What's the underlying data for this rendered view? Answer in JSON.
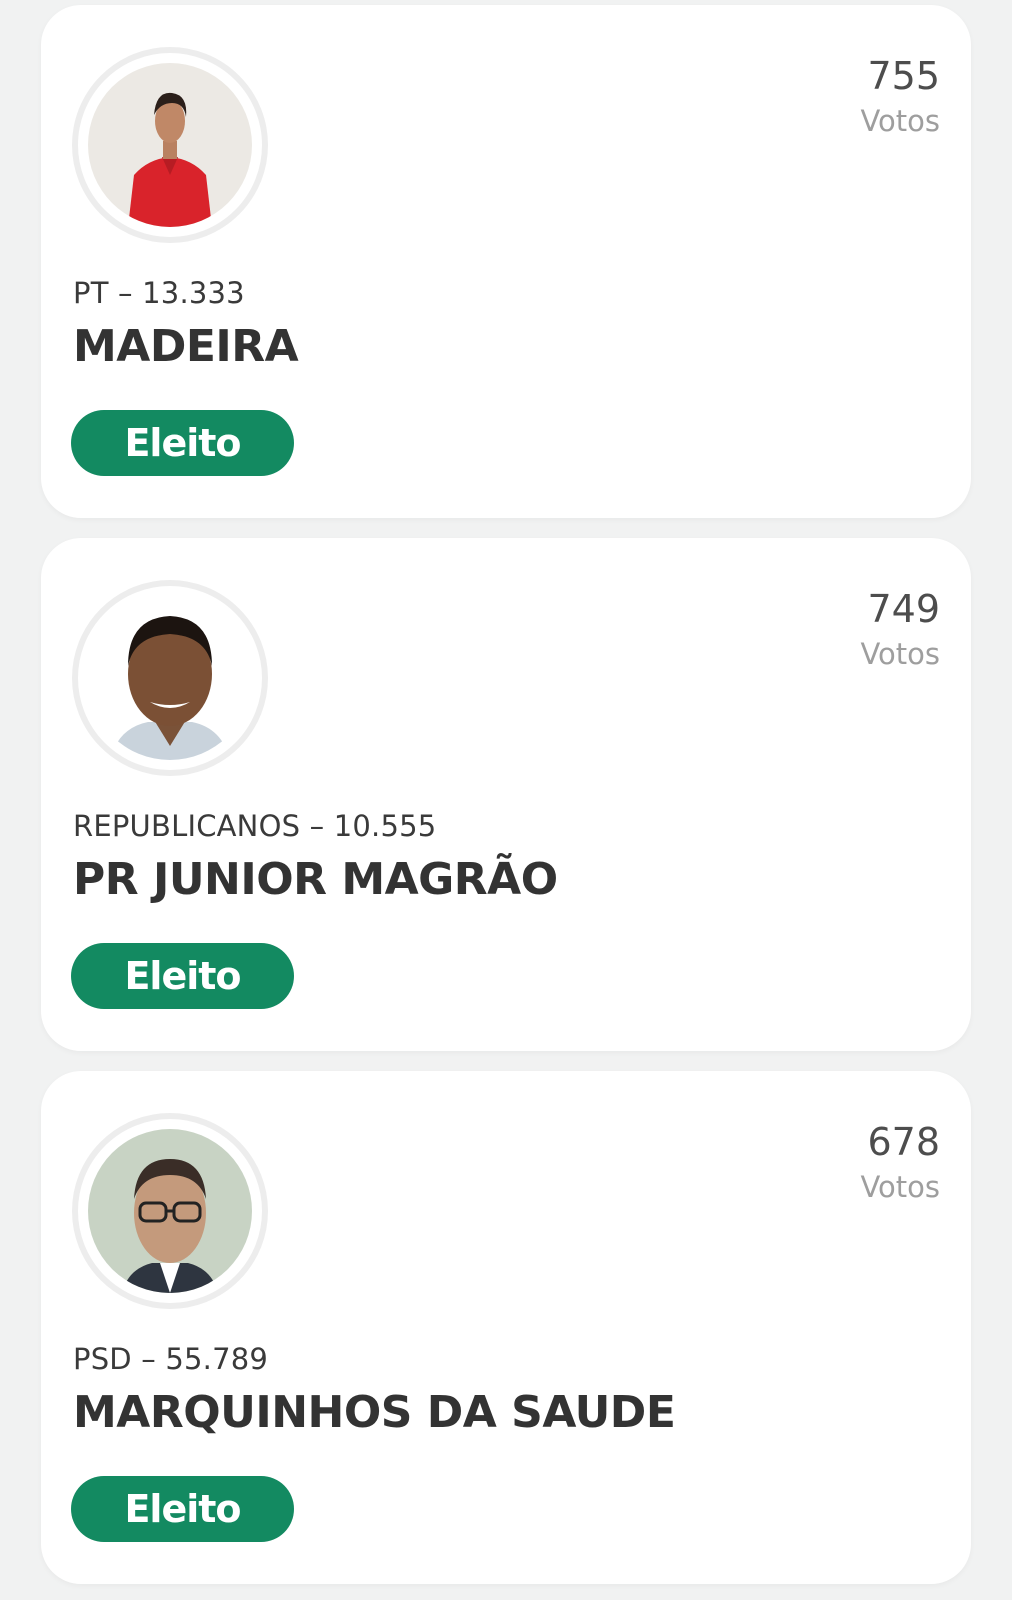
{
  "candidates": [
    {
      "votes": "755",
      "votes_label": "Votos",
      "party": "PT – 13.333",
      "name": "MADEIRA",
      "status": "Eleito"
    },
    {
      "votes": "749",
      "votes_label": "Votos",
      "party": "REPUBLICANOS – 10.555",
      "name": "PR JUNIOR MAGRÃO",
      "status": "Eleito"
    },
    {
      "votes": "678",
      "votes_label": "Votos",
      "party": "PSD – 55.789",
      "name": "MARQUINHOS DA SAUDE",
      "status": "Eleito"
    }
  ],
  "colors": {
    "status_badge": "#138a61",
    "card_background": "#ffffff",
    "page_background": "#f1f2f2"
  }
}
